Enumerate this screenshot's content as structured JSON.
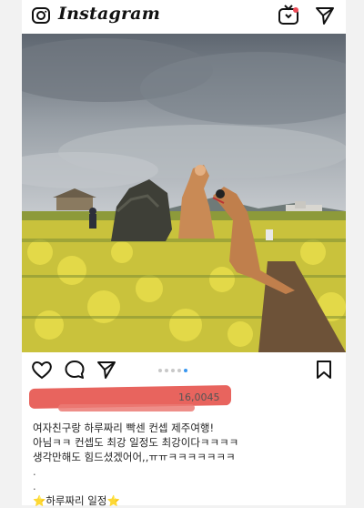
{
  "app": {
    "brand": "Instagram"
  },
  "post": {
    "likes_partial": "16,0045",
    "caption_lines": [
      "여자친구랑 하루짜리 빡센 컨셉 제주여행!",
      "아님ㅋㅋ 컨셉도 최강 일정도 최강이다ㅋㅋㅋㅋ",
      "생각만해도 힘드셨겠어어,,ㅠㅠㅋㅋㅋㅋㅋㅋㅋ",
      ".",
      ".",
      "⭐하루짜리 일정⭐"
    ],
    "carousel": {
      "count": 5,
      "active_index": 4
    }
  },
  "icons": {
    "camera": "camera-icon",
    "igtv": "igtv-icon",
    "direct": "direct-send-icon",
    "like": "heart-icon",
    "comment": "comment-icon",
    "share": "share-icon",
    "save": "bookmark-icon"
  },
  "colors": {
    "accent": "#3897f0",
    "redaction": "#e8645e"
  }
}
